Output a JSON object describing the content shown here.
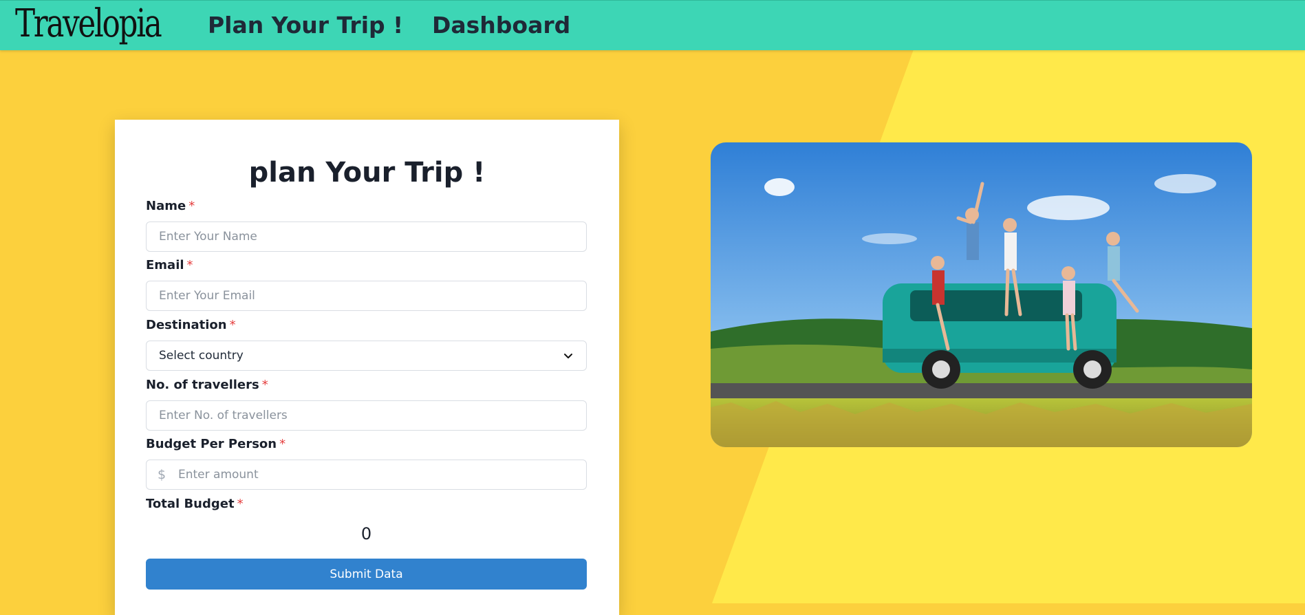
{
  "nav": {
    "logo": "Travelopia",
    "links": [
      "Plan Your Trip !",
      "Dashboard"
    ]
  },
  "form": {
    "title": "plan Your Trip !",
    "required_mark": "*",
    "name": {
      "label": "Name",
      "placeholder": "Enter Your Name"
    },
    "email": {
      "label": "Email",
      "placeholder": "Enter Your Email"
    },
    "destination": {
      "label": "Destination",
      "selected": "Select country"
    },
    "travellers": {
      "label": "No. of travellers",
      "placeholder": "Enter No. of travellers"
    },
    "budget": {
      "label": "Budget Per Person",
      "currency_symbol": "$",
      "placeholder": "Enter amount"
    },
    "total_budget": {
      "label": "Total Budget",
      "value": "0"
    },
    "submit_label": "Submit Data"
  },
  "colors": {
    "navbar": "#3dd6b5",
    "background_left": "#fcd03d",
    "background_right": "#ffe94a",
    "submit": "#3182ce",
    "required": "#e53e3e"
  },
  "hero_image": {
    "description_icon": "travel-photo"
  }
}
